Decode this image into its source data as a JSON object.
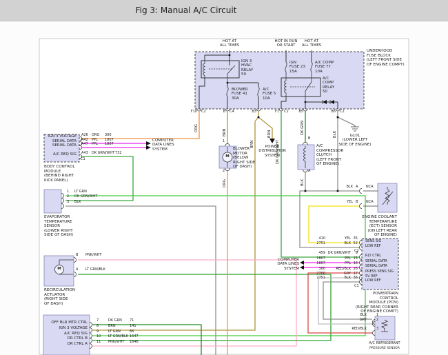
{
  "title": "Fig 3: Manual A/C Circuit",
  "colors": {
    "accent_bar": "#d2d2d2",
    "box_fill": "#d9d9f3",
    "org": "#f09340",
    "brn": "#b29339",
    "ppl": "#ee22ee",
    "dk_grn_wht": "#3aa63a",
    "lt_grn": "#44cc44",
    "dk_grn": "#1e8c1e",
    "lt_grn_blk": "#2ca02c",
    "pnk_wht": "#ffaec8",
    "blk": "#8f8f8f",
    "yel": "#f2e20a",
    "red_blk": "#dd4444",
    "gry": "#bdbdbd"
  },
  "fuse_block": {
    "feed_left": "HOT AT\nALL TIMES",
    "feed_mid": "HOT IN RUN\nOR START",
    "feed_right": "HOT AT\nALL TIMES",
    "relay_hvac": "IGN 3\nHVAC\nRELAY\n59",
    "relay_accomp": "A/C\nCOMP\nRELAY\n50",
    "fuse_blower": "BLOWER\nFUSE 41\n30A",
    "fuse_ac": "A/C\nFUSE 5\n10A",
    "fuse_ign": "IGN\nFUSE 23\n15A",
    "fuse_accomp": "A/C COMP\nFUSE 77\n10A",
    "name": "UNDERHOOD\nFUSE BLOCK\n(LEFT FRONT SIDE\nOF ENGINE COMPT)",
    "pins": {
      "f10": "F10",
      "f10c": "C2",
      "b": "B",
      "bc": "C4",
      "b3": "B3",
      "f1": "F1",
      "f1c": "C2",
      "b5": "B5",
      "b6": "B6",
      "b6c": "C2"
    }
  },
  "bcm": {
    "rows": [
      {
        "label": "IGN 3 VOLTAGE",
        "pin": "A26",
        "color": "ORG",
        "ckt": "300"
      },
      {
        "label": "SERIAL DATA",
        "pin": "A42",
        "color": "PPL",
        "ckt": "1807"
      },
      {
        "label": "SERIAL DATA",
        "pin": "A47",
        "color": "PPL",
        "ckt": "1807"
      },
      {
        "label": "A/C REQ SIG",
        "pin": "A43",
        "color": "DK GRN/WHT",
        "ckt": "732"
      }
    ],
    "conn": "C1",
    "name": "BODY CONTROL\nMODULE\n(BEHIND RIGHT\nKICK PANEL)"
  },
  "computer_data_left": "COMPUTER\nDATA LINES\nSYSTEM",
  "computer_data_right": "COMPUTER\nDATA LINES\nSYSTEM",
  "power_dist": "POWER\nDISTRIBUTION\nSYSTEM",
  "evaporator": {
    "rows": [
      {
        "pin": "1",
        "color": "LT GRN"
      },
      {
        "pin": "2",
        "color": "DK GRN/WHT"
      },
      {
        "pin": "3",
        "color": "BLK"
      }
    ],
    "name": "EVAPORATOR\nTEMPERATURE\nSENSOR\n(LOWER RIGHT\nSIDE OF DASH)"
  },
  "recirc": {
    "rows": [
      {
        "pin": "B",
        "color": "PNK/WHT"
      },
      {
        "pin": "A",
        "color": "LT GRN/BLK"
      }
    ],
    "motor": "M",
    "name": "RECIRCULATION\nACTUATOR\n(RIGHT SIDE\nOF DASH)"
  },
  "blower": {
    "pin_top": "1",
    "pin_bottom": "2",
    "motor": "M",
    "name": "BLOWER\nMOTOR\n(BELOW\nRIGHT SIDE\nOF DASH)"
  },
  "clutch": {
    "pin_top": "B",
    "pin_bottom": "A",
    "name": "A/C\nCOMPRESSOR\nCLUTCH\n(LEFT FRONT\nOF ENGINE)"
  },
  "g101": "G101\n(LOWER LEFT\nSIDE OF ENGINE)",
  "ect": {
    "row_a": {
      "color": "BLK",
      "pin": "A",
      "nc": "NCA"
    },
    "row_b": {
      "color": "YEL",
      "pin": "B",
      "nc": "NCA"
    },
    "name": "ENGINE COOLANT\nTEMPERATURE\n(ECT) SENSOR\n(ON LEFT REAR\nOF ENGINE)"
  },
  "pcm": {
    "rows": [
      {
        "ckt": "410",
        "color": "YEL",
        "pin": "35",
        "label": "SENS SIG"
      },
      {
        "ckt": "2751",
        "color": "BLK",
        "pin": "52",
        "label": "LOW REF"
      },
      {
        "ckt": "459",
        "color": "DK GRN/WHT",
        "pin": "9",
        "label": "RLY CTRL"
      },
      {
        "ckt": "1807",
        "color": "PPL",
        "pin": "15",
        "label": "SERIAL DATA"
      },
      {
        "ckt": "1807",
        "color": "PPL",
        "pin": "16",
        "label": "SERIAL DATA"
      },
      {
        "ckt": "380",
        "color": "RED/BLK",
        "pin": "26",
        "label": "PRESS SENS SIG"
      },
      {
        "ckt": "2700",
        "color": "GRY",
        "pin": "17",
        "label": "5V REF"
      },
      {
        "ckt": "2751",
        "color": "BLK",
        "pin": "36",
        "label": "LOW REF"
      }
    ],
    "conn_top": "C2",
    "conn_bottom": "C1",
    "name": "POWERTRAIN\nCONTROL\nMODULE (PCM)\n(RIGHT REAR CORNER\nOF ENGINE COMPT)"
  },
  "pressure_sensor": {
    "rows": [
      {
        "color": "BLK",
        "pin": "1"
      },
      {
        "color": "GRY",
        "pin": "2"
      },
      {
        "color": "RED/BLK",
        "pin": "3"
      }
    ],
    "name": "A/C REFRIGERANT",
    "name2": "PRESSURE SENSOR"
  },
  "control_head": {
    "rows": [
      {
        "label": "OFF BLR MTR CTRL",
        "pin": "7",
        "color": "DK GRN",
        "ckt": "71"
      },
      {
        "label": "IGN 3 VOLTAGE",
        "pin": "8",
        "color": "BRN",
        "ckt": "141"
      },
      {
        "label": "A/C REQ SIG",
        "pin": "9",
        "color": "LT GRN",
        "ckt": "66"
      },
      {
        "label": "DR CTRL B",
        "pin": "10",
        "color": "LT GRN/BLK",
        "ckt": "1647"
      },
      {
        "label": "DR CTRL A",
        "pin": "11",
        "color": "PNK/WHT",
        "ckt": "1648"
      }
    ]
  },
  "wire_tags": {
    "org": "ORG",
    "brn": "BRN",
    "dk_grn_wht": "DK GRN/WHT",
    "dk_grn": "DK GRN",
    "blk": "BLK"
  }
}
